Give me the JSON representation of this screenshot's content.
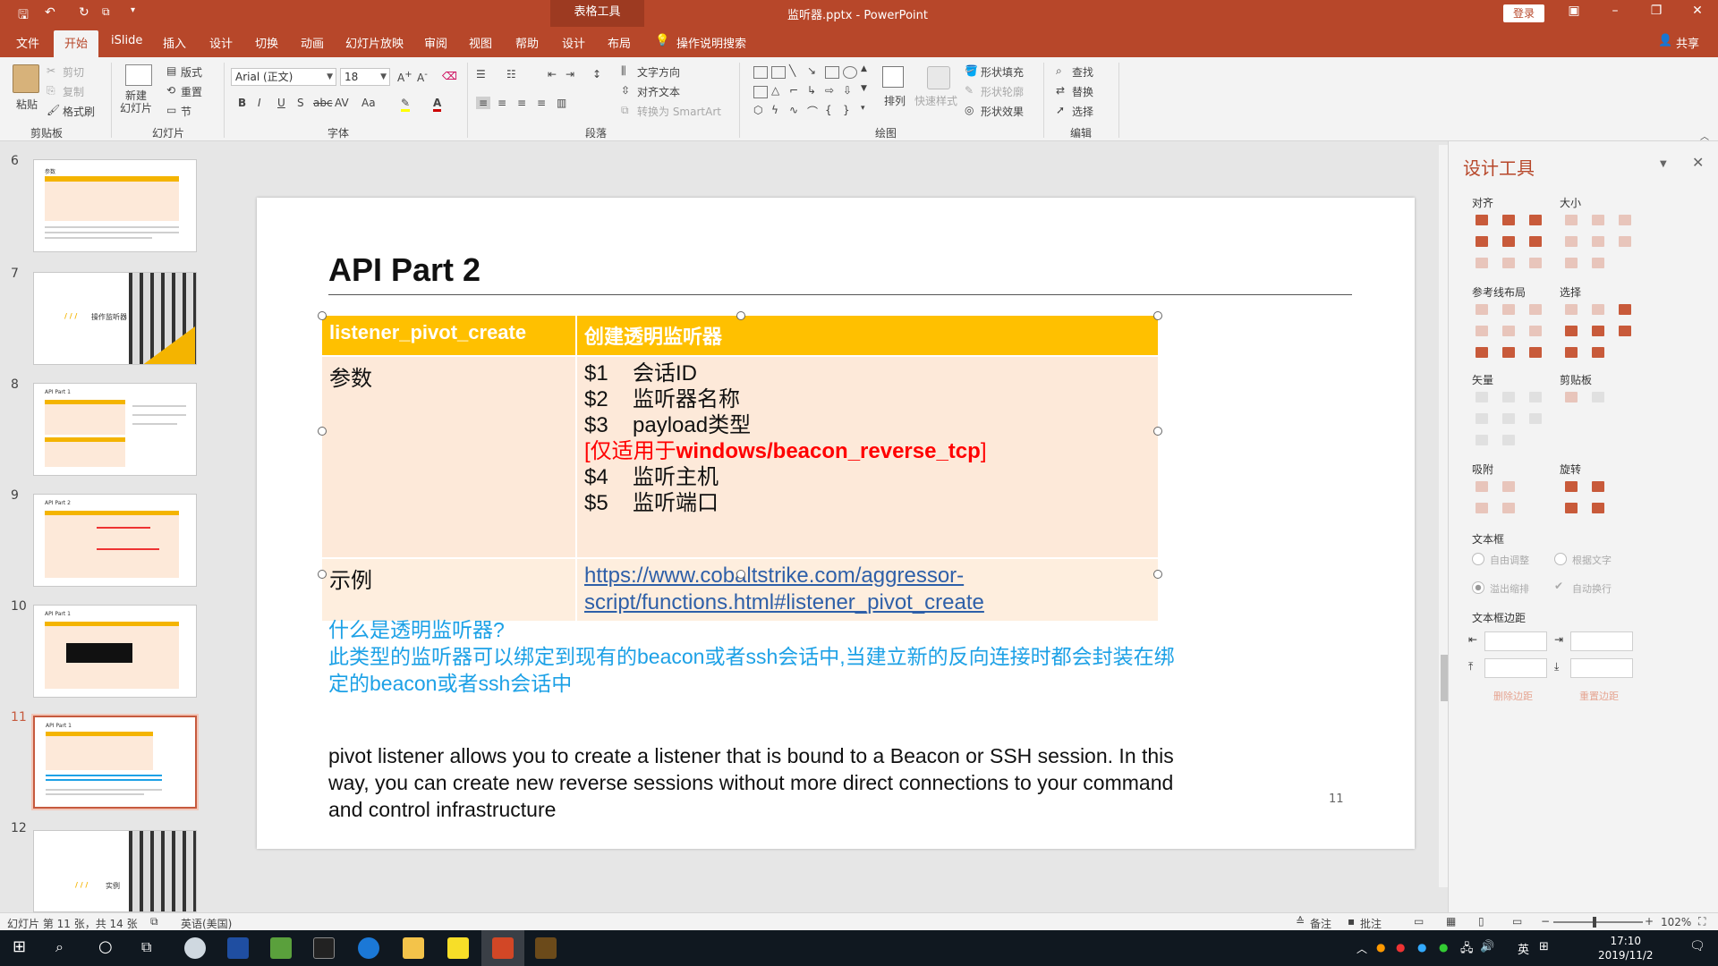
{
  "titlebar": {
    "context_group": "表格工具",
    "document_title": "监听器.pptx - PowerPoint",
    "login": "登录"
  },
  "menu": {
    "tabs": [
      "文件",
      "开始",
      "iSlide",
      "插入",
      "设计",
      "切换",
      "动画",
      "幻灯片放映",
      "审阅",
      "视图",
      "帮助",
      "设计",
      "布局"
    ],
    "active_tab": "开始",
    "tell_me": "操作说明搜索",
    "share": "共享"
  },
  "ribbon": {
    "clipboard": {
      "paste": "粘贴",
      "cut": "剪切",
      "copy": "复制",
      "format_painter": "格式刷",
      "label": "剪贴板"
    },
    "slides": {
      "new_slide": "新建\n幻灯片",
      "layout": "版式",
      "reset": "重置",
      "section": "节",
      "label": "幻灯片"
    },
    "font": {
      "name": "Arial (正文)",
      "size": "18",
      "label": "字体"
    },
    "paragraph": {
      "text_direction": "文字方向",
      "align_text": "对齐文本",
      "smartart": "转换为 SmartArt",
      "label": "段落"
    },
    "drawing": {
      "arrange": "排列",
      "quick_styles": "快速样式",
      "shape_fill": "形状填充",
      "shape_outline": "形状轮廓",
      "shape_effects": "形状效果",
      "label": "绘图"
    },
    "editing": {
      "find": "查找",
      "replace": "替换",
      "select": "选择",
      "label": "编辑"
    }
  },
  "thumbnails": [
    {
      "num": "6",
      "title": "参数"
    },
    {
      "num": "7",
      "title": "操作监听器"
    },
    {
      "num": "8",
      "title": "API Part 1"
    },
    {
      "num": "9",
      "title": "API Part 2"
    },
    {
      "num": "10",
      "title": "API Part 1"
    },
    {
      "num": "11",
      "title": "API Part 1",
      "selected": true
    },
    {
      "num": "12",
      "title": "实例"
    }
  ],
  "slide": {
    "title": "API Part 2",
    "table": {
      "header": [
        "listener_pivot_create",
        "创建透明监听器"
      ],
      "params_label": "参数",
      "params": [
        {
          "num": "$1",
          "text": "会话ID"
        },
        {
          "num": "$2",
          "text": "监听器名称"
        },
        {
          "num": "$3",
          "text": "payload类型"
        }
      ],
      "param_note_prefix": "[仅适用于",
      "param_note_bold": "windows/beacon_reverse_tcp",
      "param_note_suffix": "]",
      "params2": [
        {
          "num": "$4",
          "text": "监听主机"
        },
        {
          "num": "$5",
          "text": "监听端口"
        }
      ],
      "example_label": "示例",
      "example_link_1": "https://www.cobaltstrike.com/aggressor-",
      "example_link_2": "script/functions.html#listener_pivot_create"
    },
    "cn_note_1": "什么是透明监听器?",
    "cn_note_2": "此类型的监听器可以绑定到现有的beacon或者ssh会话中,当建立新的反向连接时都会封装在绑定的beacon或者ssh会话中",
    "en_note": "pivot listener allows you to create a listener that is bound to a Beacon or SSH session. In this way, you can create new reverse sessions without more direct connections to your command and control infrastructure",
    "page_number": "11"
  },
  "design_panel": {
    "title": "设计工具",
    "sections": {
      "align": "对齐",
      "size": "大小",
      "guides": "参考线布局",
      "select": "选择",
      "vector": "矢量",
      "clipboard": "剪贴板",
      "snap": "吸附",
      "rotate": "旋转",
      "textbox": "文本框",
      "textbox_margin": "文本框边距"
    },
    "options": {
      "autofit": "自由调整",
      "fit_text": "根据文字",
      "overflow": "溢出缩排",
      "wrap": "自动换行",
      "apply_margin": "删除边距",
      "reset_margin": "重置边距"
    }
  },
  "statusbar": {
    "slide_info": "幻灯片 第 11 张，共 14 张",
    "language": "英语(美国)",
    "notes": "备注",
    "comments": "批注",
    "zoom": "102%"
  },
  "taskbar": {
    "time": "17:10",
    "date": "2019/11/2",
    "ime": "英"
  },
  "colors": {
    "brand": "#b7472a",
    "table_header": "#ffc000",
    "table_body": "#fde9d9",
    "note_blue": "#1da1e6",
    "link": "#2e5fa8"
  }
}
